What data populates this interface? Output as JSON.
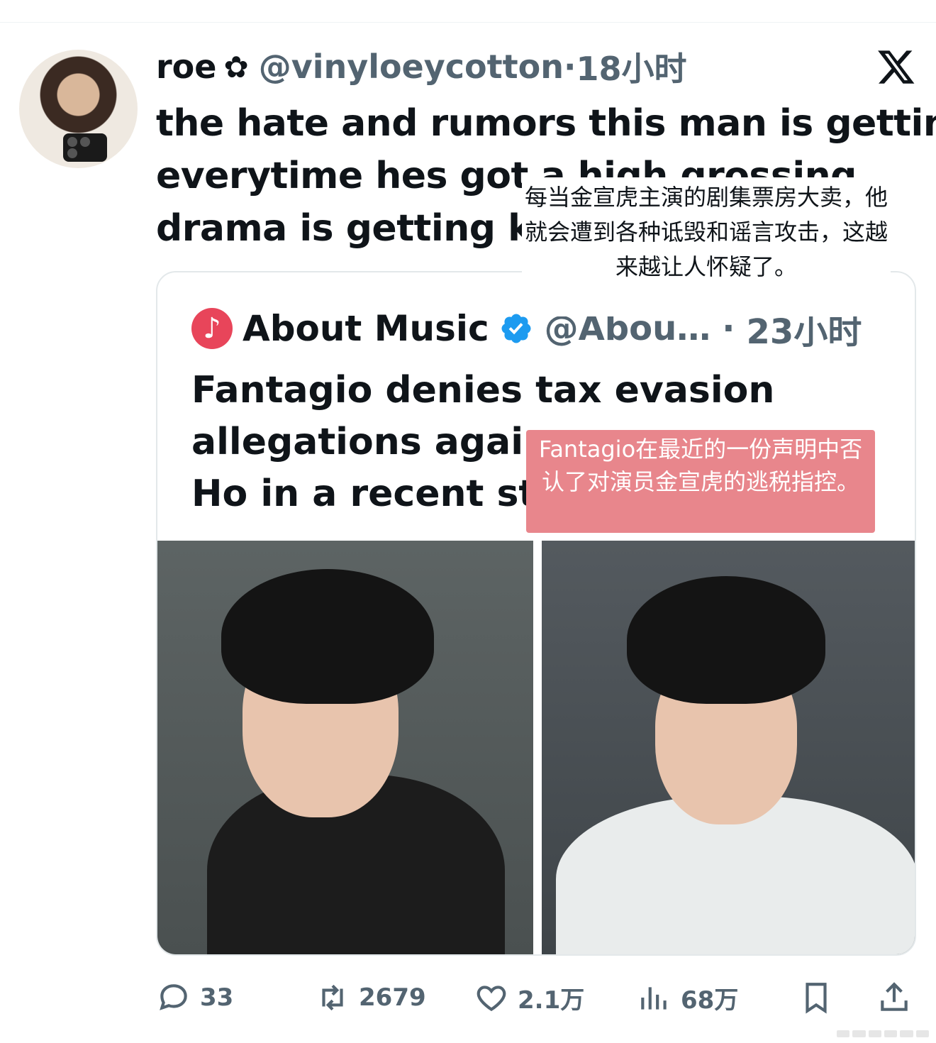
{
  "tweet": {
    "author_name": "roe",
    "flower_glyph": "✿",
    "handle": "@vinyloeycotton",
    "separator": "·",
    "time": "18小时",
    "text_lines": [
      "the hate and rumors this man is getting",
      "everytime hes got a high grossing",
      "drama is getting ki"
    ],
    "icons": {
      "avatar": "avatar",
      "platform": "x-logo-icon"
    }
  },
  "caption_overlay_1": "每当金宣虎主演的剧集票房大卖，他就会遭到各种诋毁和谣言攻击，这越来越让人怀疑了。",
  "quoted_tweet": {
    "icon_glyph": "♪",
    "name": "About Music",
    "handle": "@Abou…",
    "separator": "·",
    "time": "23小时",
    "text_lines": [
      "Fantagio denies tax evasion",
      "allegations agains",
      "Ho in a recent sta"
    ],
    "brand_color": "#e8455a"
  },
  "caption_overlay_2": "Fantagio在最近的一份声明中否认了对演员金宣虎的逃税指控。",
  "actions": {
    "reply": "33",
    "retweet": "2679",
    "like": "2.1万",
    "views": "68万"
  },
  "colors": {
    "text": "#0f1419",
    "secondary": "#536471",
    "verified": "#1d9bf0",
    "caption_bg": "#e8868c"
  }
}
